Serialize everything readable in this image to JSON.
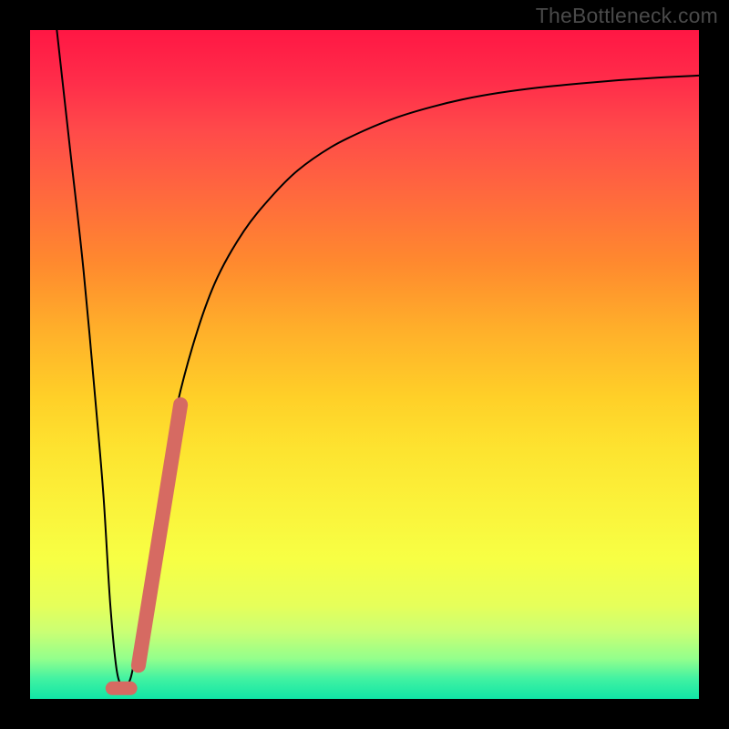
{
  "watermark": "TheBottleneck.com",
  "chart_data": {
    "type": "line",
    "title": "",
    "xlabel": "",
    "ylabel": "",
    "xlim": [
      0,
      100
    ],
    "ylim": [
      0,
      100
    ],
    "series": [
      {
        "name": "bottleneck-curve",
        "stroke": "#000000",
        "stroke_width": 2,
        "x": [
          4,
          6,
          8,
          10,
          11,
          12,
          13,
          14,
          15,
          16,
          18,
          20,
          22,
          25,
          28,
          32,
          36,
          40,
          45,
          50,
          55,
          60,
          65,
          70,
          76,
          82,
          88,
          94,
          100
        ],
        "y": [
          100,
          82,
          64,
          42,
          30,
          14,
          4,
          2,
          3,
          8,
          20,
          33,
          44,
          55,
          63,
          70,
          75,
          79,
          82.5,
          85,
          87,
          88.5,
          89.7,
          90.6,
          91.4,
          92,
          92.5,
          92.9,
          93.2
        ]
      },
      {
        "name": "highlight-up-segment",
        "stroke": "#d66a62",
        "stroke_width": 16,
        "linecap": "round",
        "x": [
          16.2,
          22.5
        ],
        "y": [
          5,
          44
        ]
      },
      {
        "name": "highlight-flat-segment",
        "stroke": "#d66a62",
        "stroke_width": 15,
        "linecap": "round",
        "x": [
          12.3,
          15.0
        ],
        "y": [
          1.6,
          1.6
        ]
      }
    ],
    "grid": false,
    "legend": false
  }
}
